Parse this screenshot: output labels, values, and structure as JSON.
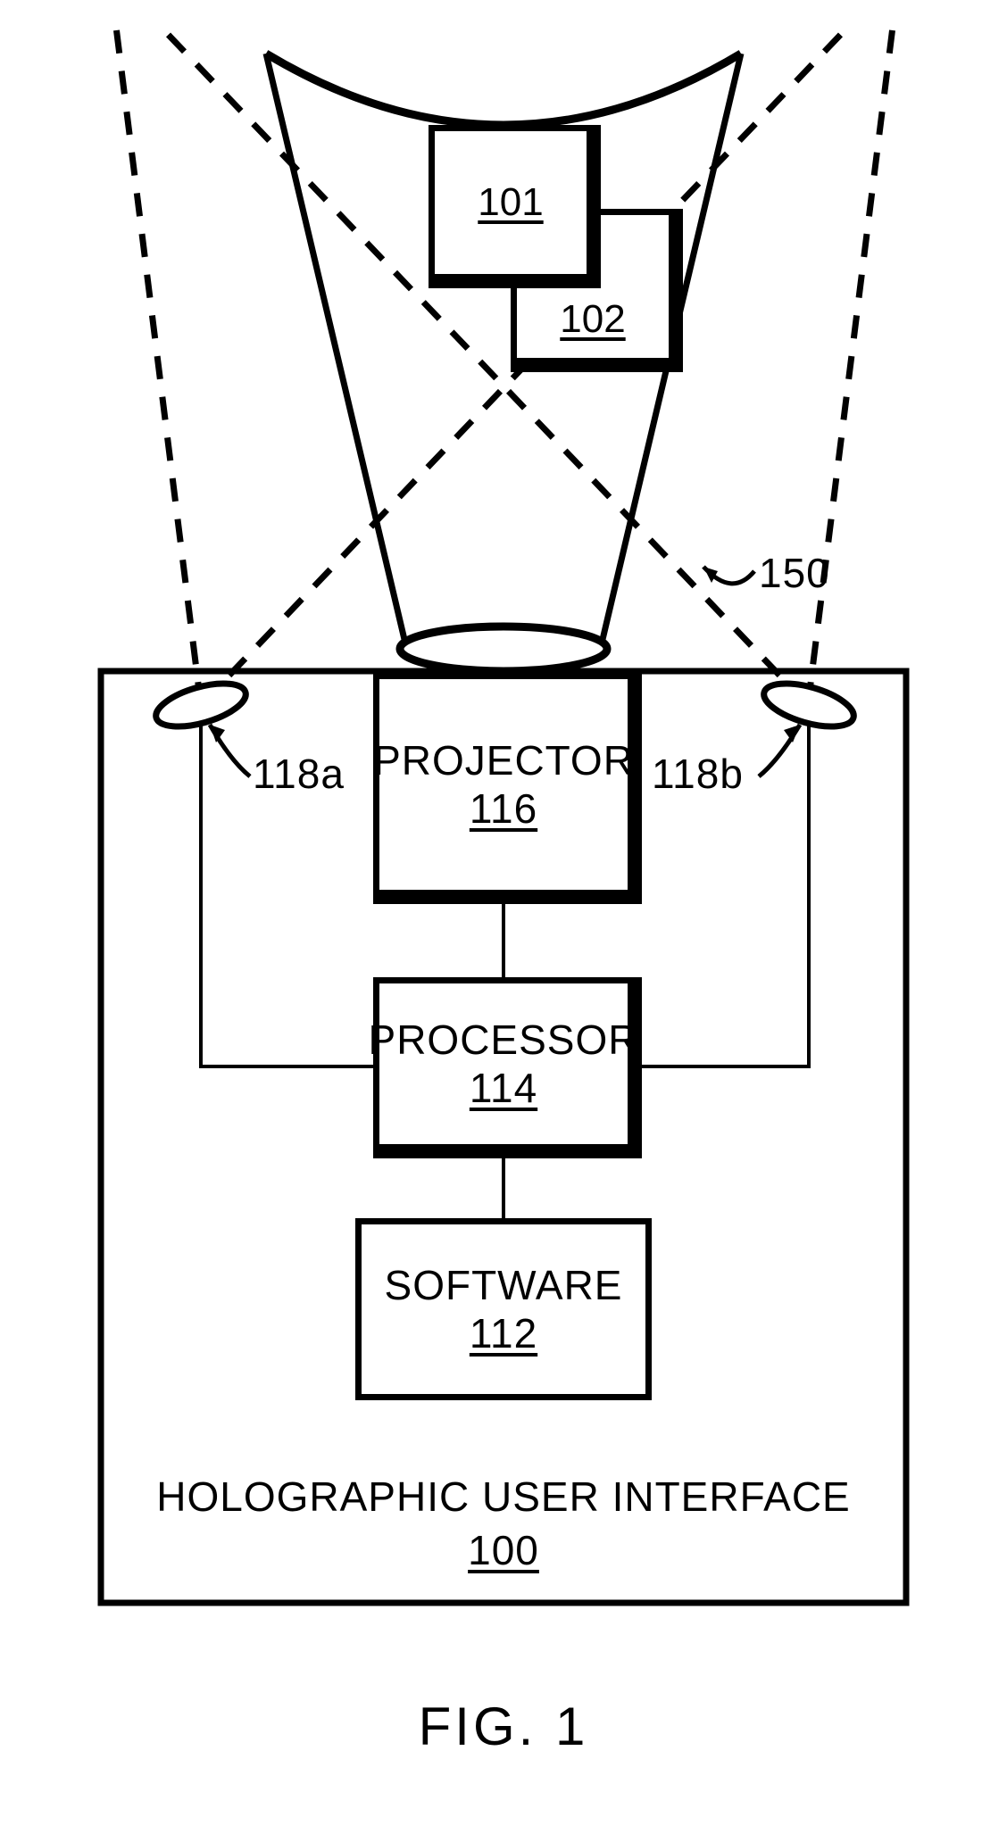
{
  "figure": {
    "caption": "FIG. 1"
  },
  "holographicInterface": {
    "label": "HOLOGRAPHIC USER INTERFACE",
    "num": "100"
  },
  "projector": {
    "label": "PROJECTOR",
    "num": "116"
  },
  "processor": {
    "label": "PROCESSOR",
    "num": "114"
  },
  "software": {
    "label": "SOFTWARE",
    "num": "112"
  },
  "projection": {
    "object1_num": "101",
    "object2_num": "102",
    "region_num": "150"
  },
  "sensors": {
    "left_num": "118a",
    "right_num": "118b"
  }
}
